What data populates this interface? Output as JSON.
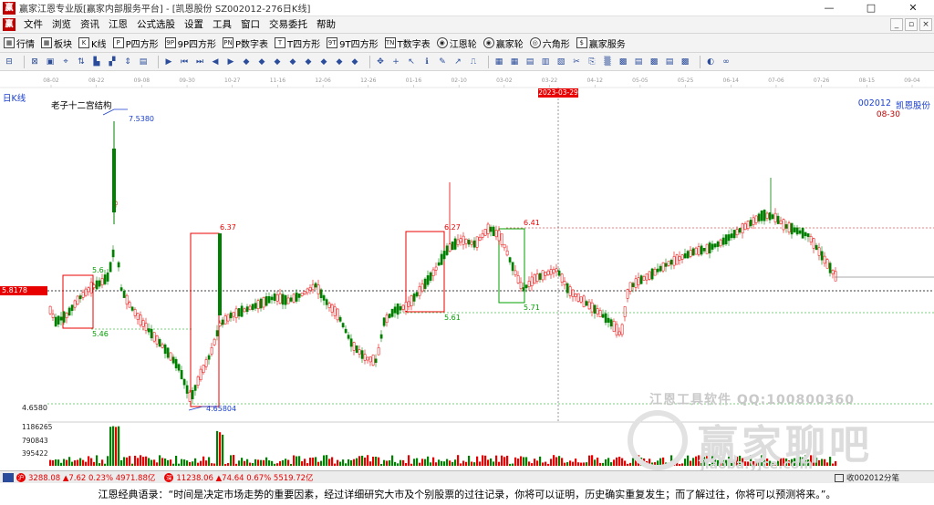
{
  "window": {
    "title": "赢家江恩专业版[赢家内部服务平台] - [凯恩股份  SZ002012-276日K线]",
    "buttons": [
      "—",
      "□",
      "✕"
    ]
  },
  "menubar": {
    "items": [
      "文件",
      "浏览",
      "资讯",
      "江恩",
      "公式选股",
      "设置",
      "工具",
      "窗口",
      "交易委托",
      "帮助"
    ],
    "mdi_buttons": [
      "_",
      "▫",
      "×"
    ]
  },
  "toolbar1": {
    "items": [
      {
        "icon": "▦",
        "label": "行情"
      },
      {
        "icon": "▦",
        "label": "板块"
      },
      {
        "icon": "K",
        "label": "K线"
      },
      {
        "icon": "P",
        "label": "P四方形"
      },
      {
        "icon": "9P",
        "label": "9P四方形"
      },
      {
        "icon": "PN",
        "label": "P数字表"
      },
      {
        "icon": "T",
        "label": "T四方形"
      },
      {
        "icon": "9T",
        "label": "9T四方形"
      },
      {
        "icon": "TN",
        "label": "T数字表"
      },
      {
        "icon": "◉",
        "label": "江恩轮"
      },
      {
        "icon": "◉",
        "label": "赢家轮"
      },
      {
        "icon": "◎",
        "label": "六角形"
      },
      {
        "icon": "$",
        "label": "赢家服务"
      }
    ]
  },
  "toolbar2": {
    "icons": [
      "⊟",
      "⊠",
      "▣",
      "⌖",
      "⇅",
      "▙",
      "▞",
      "⇕",
      "▤",
      "▶",
      "⏮",
      "⏭",
      "◀",
      "▶",
      "◆",
      "◆",
      "◆",
      "◆",
      "◆",
      "◆",
      "◆",
      "◆",
      "✥",
      "+",
      "↖",
      "ℹ",
      "✎",
      "↗",
      "⎍",
      "▦",
      "▦",
      "▤",
      "▥",
      "▧",
      "✂",
      "⎘",
      "▒",
      "▩",
      "▤",
      "▩",
      "▤",
      "▩",
      "◐",
      "∞"
    ]
  },
  "chart": {
    "period_label": "日K线",
    "indicator_name": "老子十二宫结构",
    "stock_code": "002012",
    "stock_name": "凯恩股份",
    "date_flag": "08-30",
    "cursor_date": "2023-03-29",
    "current_price": "5.8178",
    "low_price": "4.6580",
    "date_ticks": [
      "08-02",
      "08-22",
      "09-08",
      "09-30",
      "10-27",
      "11-16",
      "12-06",
      "12-26",
      "01-16",
      "02-10",
      "03-02",
      "03-22",
      "04-12",
      "05-05",
      "05-25",
      "06-14",
      "07-06",
      "07-26",
      "08-15",
      "09-04"
    ],
    "price_labels": [
      "7.5380",
      "6.37",
      "5.6",
      "5.46",
      "4.65",
      "6.27",
      "5.61",
      "6.41",
      "5.71",
      "4.65804"
    ],
    "volume_labels": [
      "1186265",
      "790843",
      "395422"
    ]
  },
  "watermark": {
    "text": "江恩工具软件  QQ:100800360",
    "brand": "赢家聊吧",
    "url": "jiaoba.yjce.com"
  },
  "statusbar": {
    "indices": [
      {
        "badge": "沪",
        "text": "3288.08 ▲7.62 0.23% 4971.88亿"
      },
      {
        "badge": "深",
        "text": "11238.06 ▲74.64 0.67% 5519.72亿"
      }
    ],
    "right_text": "收002012分笔"
  },
  "quote": {
    "text": "江恩经典语录：“时间是决定市场走势的重要因素，经过详细研究大市及个别股票的过往记录，你将可以证明，历史确实重复发生；而了解过往，你将可以预测将来。”。"
  },
  "colors": {
    "up": "#e80000",
    "down": "#008000",
    "accent_blue": "#1a3fd0",
    "box_red": "#e80000",
    "box_green": "#00a000"
  }
}
